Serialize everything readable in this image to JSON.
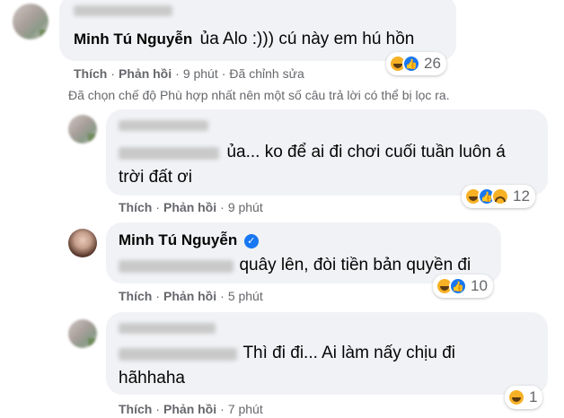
{
  "comments": [
    {
      "author": "Minh Tú Nguyễn",
      "text": "ủa Alo :))) cú này em hú hồn",
      "actions": {
        "like": "Thích",
        "reply": "Phản hồi",
        "time": "9 phút",
        "edited": "Đã chỉnh sửa"
      },
      "reactions": {
        "icons": [
          "haha-icon",
          "like-icon"
        ],
        "count": "26"
      }
    },
    {
      "line1": "ủa... ko để ai đi chơi cuối tuần luôn á",
      "line2": "trời đất ơi",
      "actions": {
        "like": "Thích",
        "reply": "Phản hồi",
        "time": "9 phút"
      },
      "reactions": {
        "icons": [
          "haha-icon",
          "like-icon",
          "sad-icon"
        ],
        "count": "12"
      }
    },
    {
      "author": "Minh Tú Nguyễn",
      "text": "quây lên, đòi tiền bản quyền đi",
      "actions": {
        "like": "Thích",
        "reply": "Phản hồi",
        "time": "5 phút"
      },
      "reactions": {
        "icons": [
          "haha-icon",
          "like-icon"
        ],
        "count": "10"
      }
    },
    {
      "line1": "Thì đi đi... Ai làm nấy chịu đi",
      "line2": "hãhhaha",
      "actions": {
        "like": "Thích",
        "reply": "Phản hồi",
        "time": "7 phút"
      },
      "reactions": {
        "icons": [
          "haha-icon"
        ],
        "count": "1"
      }
    }
  ],
  "filter_notice": "Đã chọn chế độ Phù hợp nhất nên một số câu trả lời có thể bị lọc ra.",
  "separator": "·",
  "colors": {
    "bubble": "#f0f2f5",
    "meta": "#65676b",
    "like": "#1877f2",
    "haha": "#f7b125"
  }
}
